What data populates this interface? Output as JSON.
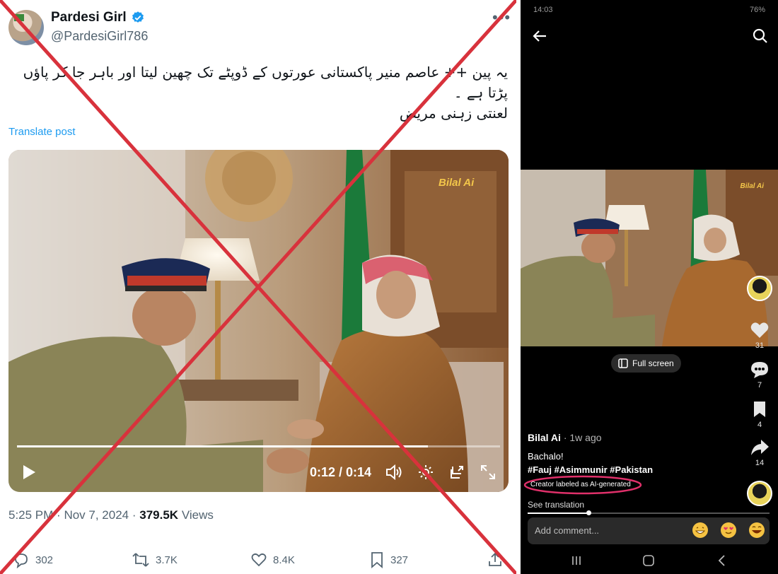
{
  "tweet": {
    "display_name": "Pardesi Girl",
    "handle": "@PardesiGirl786",
    "text_line1": "یہ پین ++ عاصم منیر پاکستانی عورتوں کے ڈوپٹے تک چھین لیتا اور باہر جا کر پاؤں",
    "text_line2": "پڑتا ہے ۔",
    "text_line3": "لعنتی زہنی مریض",
    "translate": "Translate post",
    "video": {
      "watermark": "Bilal Ai",
      "timecode": "0:12 / 0:14",
      "progress": 0.85
    },
    "time": "5:25 PM",
    "date": "Nov 7, 2024",
    "views_count": "379.5K",
    "views_label": "Views",
    "replies": "302",
    "reposts": "3.7K",
    "likes": "8.4K",
    "bookmarks": "327"
  },
  "phone": {
    "status_time": "14:03",
    "battery": "76%",
    "video_watermark": "Bilal Ai",
    "fullscreen_label": "Full screen",
    "likes": "31",
    "comments": "7",
    "saves": "4",
    "shares": "14",
    "author": "Bilal Ai",
    "ago": "· 1w ago",
    "caption": "Bachalo!",
    "hashtags": "#Fauj #Asimmunir #Pakistan",
    "ai_label": "Creator labeled as AI-generated",
    "see_translation": "See translation",
    "comment_placeholder": "Add comment...",
    "progress": 0.25
  },
  "colors": {
    "cross": "#d8323c",
    "ai_oval": "#e0306a",
    "link_blue": "#1d9bf0",
    "verified_blue": "#1d9bf0"
  }
}
